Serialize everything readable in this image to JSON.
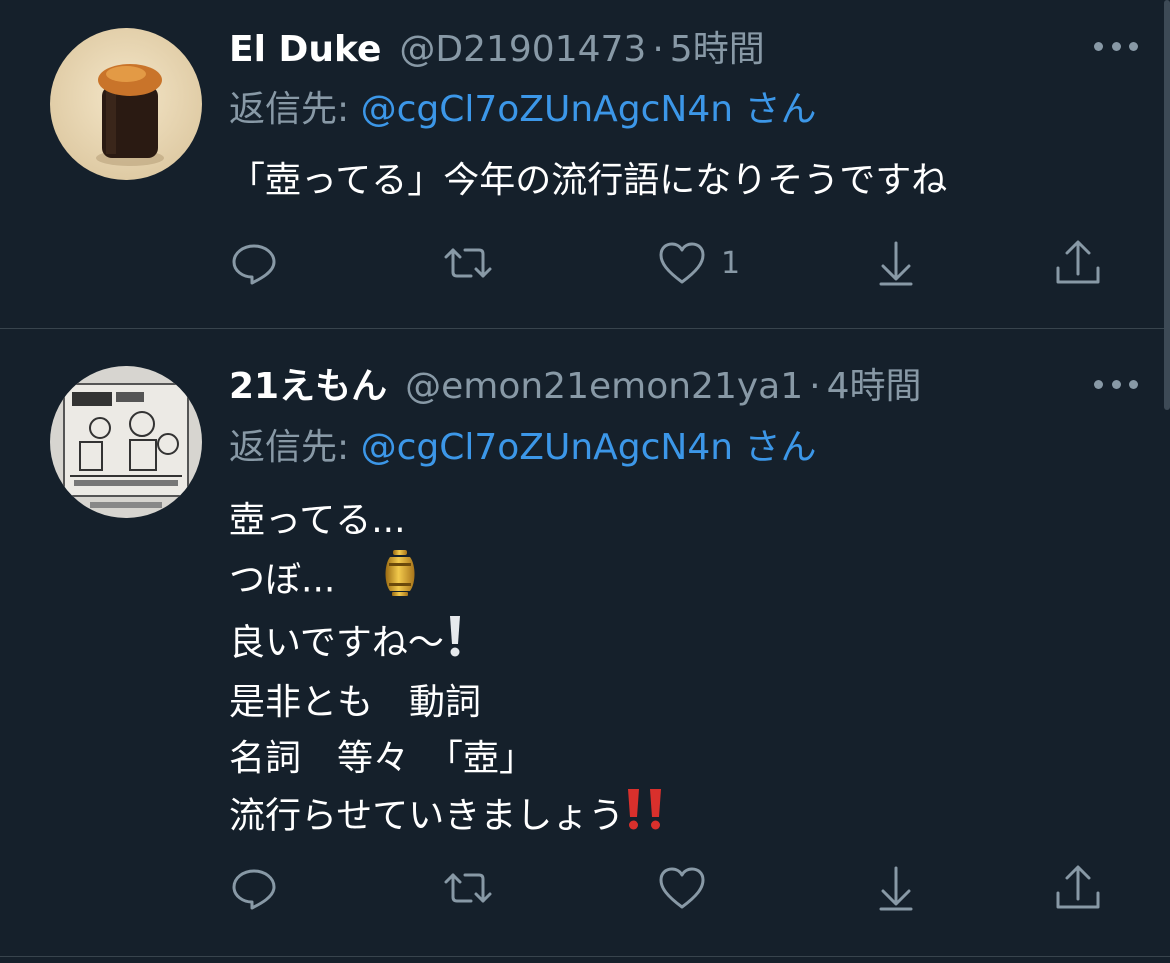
{
  "colors": {
    "background": "#15202b",
    "divider": "#38444d",
    "secondary_text": "#8899a6",
    "link": "#3c97e8",
    "primary_text": "#ffffff"
  },
  "tweets": [
    {
      "display_name": "El Duke",
      "handle": "@D21901473",
      "separator": "·",
      "time": "5時間",
      "reply_label": "返信先:",
      "reply_mention": "@cgCl7oZUnAgcN4n",
      "reply_suffix": "さん",
      "lines": [
        "「壺ってる」今年の流行語になりそうですね"
      ],
      "avatar_icon": "sushi-photo-avatar",
      "actions": {
        "reply_icon": "reply-icon",
        "retweet_icon": "retweet-icon",
        "like_icon": "heart-icon",
        "like_count": "1",
        "download_icon": "download-icon",
        "share_icon": "share-icon"
      }
    },
    {
      "display_name": "21えもん",
      "handle": "@emon21emon21ya1",
      "separator": "·",
      "time": "4時間",
      "reply_label": "返信先:",
      "reply_mention": "@cgCl7oZUnAgcN4n",
      "reply_suffix": "さん",
      "lines": [
        "壺ってる...",
        "つぼ...",
        "良いですね〜",
        "是非とも　動詞",
        "名詞　等々　「壺」",
        "流行らせていきましょう"
      ],
      "avatar_icon": "newspaper-cartoon-avatar",
      "emojis": [
        "urn-emoji",
        "white-exclamation-emoji",
        "double-exclamation-emoji"
      ],
      "actions": {
        "reply_icon": "reply-icon",
        "retweet_icon": "retweet-icon",
        "like_icon": "heart-icon",
        "like_count": "",
        "download_icon": "download-icon",
        "share_icon": "share-icon"
      }
    }
  ]
}
